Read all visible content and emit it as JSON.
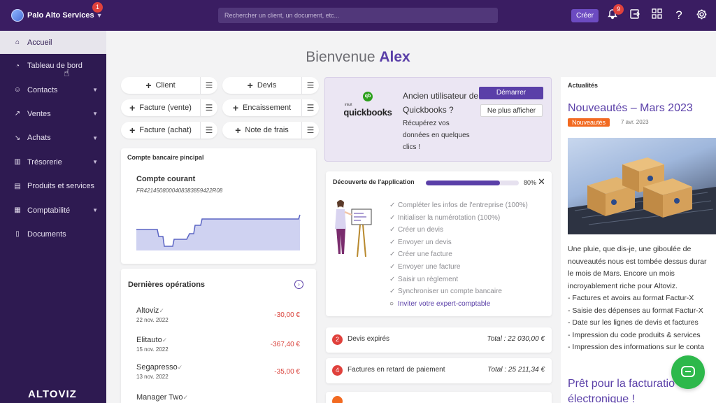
{
  "header": {
    "company_name": "Palo Alto Services",
    "company_badge": "1",
    "search_placeholder": "Rechercher un client, un document, etc...",
    "create_label": "Créer",
    "notification_count": "9",
    "help_label": "?"
  },
  "sidebar": {
    "items": [
      {
        "label": "Accueil",
        "icon": "home-icon",
        "chevron": false
      },
      {
        "label": "Tableau de bord",
        "icon": "dashboard-icon",
        "chevron": false
      },
      {
        "label": "Contacts",
        "icon": "user-icon",
        "chevron": true
      },
      {
        "label": "Ventes",
        "icon": "trend-up-icon",
        "chevron": true
      },
      {
        "label": "Achats",
        "icon": "trend-down-icon",
        "chevron": true
      },
      {
        "label": "Trésorerie",
        "icon": "bank-icon",
        "chevron": true
      },
      {
        "label": "Produits et services",
        "icon": "cart-icon",
        "chevron": false
      },
      {
        "label": "Comptabilité",
        "icon": "calculator-icon",
        "chevron": true
      },
      {
        "label": "Documents",
        "icon": "document-icon",
        "chevron": false
      }
    ],
    "logo_text": "ALTOVIZ"
  },
  "welcome": {
    "prefix": "Bienvenue",
    "name": "Alex"
  },
  "quick_actions": [
    {
      "label": "Client"
    },
    {
      "label": "Devis"
    },
    {
      "label": "Facture (vente)"
    },
    {
      "label": "Encaissement"
    },
    {
      "label": "Facture (achat)"
    },
    {
      "label": "Note de frais"
    }
  ],
  "bank": {
    "title": "Compte bancaire pincipal",
    "account_name": "Compte courant",
    "iban": "FR4214508000408383859422R08"
  },
  "operations": {
    "title": "Dernières opérations",
    "rows": [
      {
        "name": "Altoviz",
        "date": "22 nov. 2022",
        "amount": "-30,00 €"
      },
      {
        "name": "Elitauto",
        "date": "15 nov. 2022",
        "amount": "-367,40 €"
      },
      {
        "name": "Segapresso",
        "date": "13 nov. 2022",
        "amount": "-35,00 €"
      },
      {
        "name": "Manager Two",
        "date": "",
        "amount": ""
      }
    ]
  },
  "quickbooks": {
    "logo_small": "intuit",
    "logo_text": "quickbooks",
    "text": "Ancien utilisateur de Quickbooks ?",
    "subtext": "Récupérez vos données en quelques clics !",
    "start_label": "Démarrer",
    "hide_label": "Ne plus afficher"
  },
  "discovery": {
    "title": "Découverte de l'application",
    "progress_percent": 80,
    "progress_label": "80%",
    "close_label": "✕",
    "tasks": [
      {
        "label": "Compléter les infos de l'entreprise (100%)",
        "done": true
      },
      {
        "label": "Initialiser la numérotation (100%)",
        "done": true
      },
      {
        "label": "Créer un devis",
        "done": true
      },
      {
        "label": "Envoyer un devis",
        "done": true
      },
      {
        "label": "Créer une facture",
        "done": true
      },
      {
        "label": "Envoyer une facture",
        "done": true
      },
      {
        "label": "Saisir un règlement",
        "done": true
      },
      {
        "label": "Synchroniser un compte bancaire",
        "done": true
      },
      {
        "label": "Inviter votre expert-comptable",
        "done": false
      }
    ]
  },
  "alerts": [
    {
      "count": "2",
      "label": "Devis expirés",
      "total": "Total : 22 030,00 €"
    },
    {
      "count": "4",
      "label": "Factures en retard de paiement",
      "total": "Total : 25 211,34 €"
    }
  ],
  "news": {
    "header": "Actualités",
    "title": "Nouveautés – Mars 2023",
    "tag": "Nouveautés",
    "date": "7 avr. 2023",
    "body_lines": [
      "Une pluie, que dis-je, une giboulée de",
      "nouveautés nous est tombée dessus durar",
      "le mois de Mars. Encore un mois",
      "incroyablement riche pour Altoviz.",
      "- Factures et avoirs au format Factur-X",
      "- Saisie des dépenses au format Factur-X",
      "- Date sur les lignes de devis et factures",
      "- Impression du code produits & services",
      "- Impression des informations sur le conta"
    ],
    "next_title_1": "Prêt pour la facturatio",
    "next_title_2": "électronique !"
  },
  "colors": {
    "topbar": "#3a1d62",
    "sidebar": "#2e1a51",
    "accent": "#5a3fa8",
    "danger": "#e0413c",
    "tag": "#f26a21",
    "chat": "#2db84b"
  }
}
